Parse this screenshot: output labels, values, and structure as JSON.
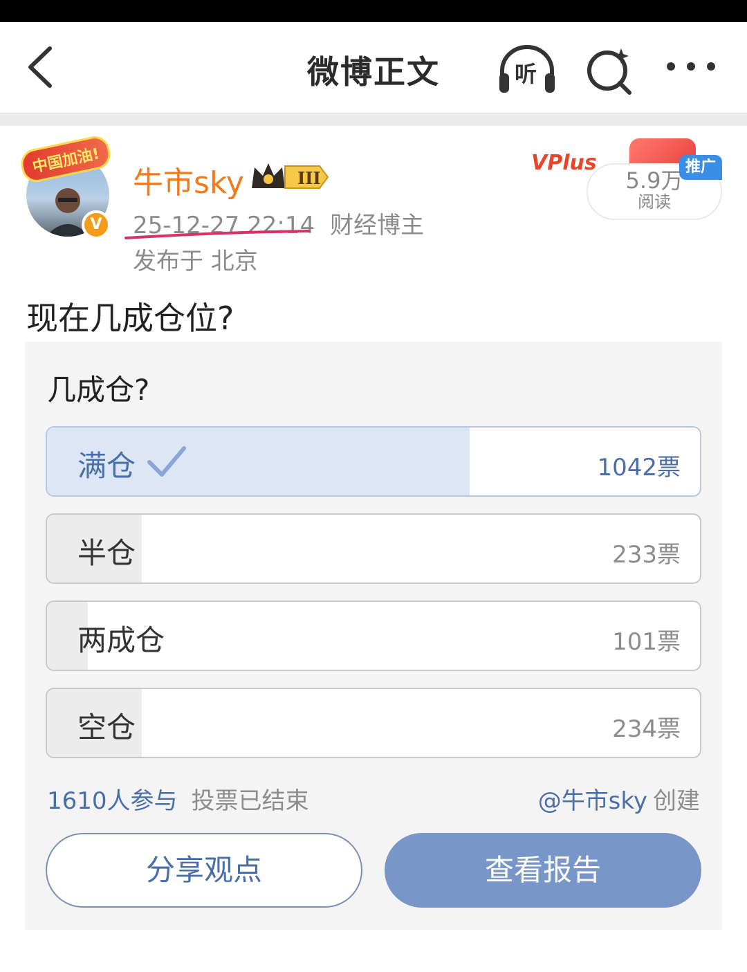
{
  "navbar": {
    "title": "微博正文",
    "listen_label": "听",
    "icons": [
      "back-arrow-icon",
      "headphones-icon",
      "search-icon",
      "more-icon"
    ]
  },
  "author": {
    "avatar_banner": "中国加油!",
    "verified_mark": "V",
    "name": "牛市sky",
    "member_level": "III",
    "timestamp": "25-12-27 22:14",
    "category": "财经博主",
    "location": "发布于 北京"
  },
  "ad": {
    "brand": "VPlus",
    "badge": "推广",
    "reads": "5.9万",
    "reads_label": "阅读"
  },
  "post": {
    "text": "现在几成仓位?"
  },
  "poll": {
    "question": "几成仓?",
    "total_votes": 1610,
    "options": [
      {
        "label": "满仓",
        "votes": "1042票",
        "vote_count": 1042,
        "share": 0.647,
        "selected": true
      },
      {
        "label": "半仓",
        "votes": "233票",
        "vote_count": 233,
        "share": 0.145,
        "selected": false
      },
      {
        "label": "两成仓",
        "votes": "101票",
        "vote_count": 101,
        "share": 0.063,
        "selected": false
      },
      {
        "label": "空仓",
        "votes": "234票",
        "vote_count": 234,
        "share": 0.145,
        "selected": false
      }
    ],
    "participants": "1610人参与",
    "status": "投票已结束",
    "creator": "@牛市sky",
    "created_label": "创建",
    "share_button": "分享观点",
    "report_button": "查看报告"
  },
  "colors": {
    "accent_blue": "#4a6ea8",
    "report_button_bg": "#7896c8",
    "username_orange": "#f07a1c",
    "underline_pink": "#d6336c"
  }
}
